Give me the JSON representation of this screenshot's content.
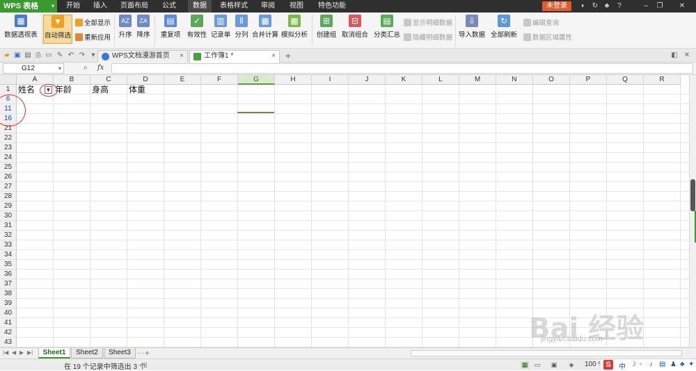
{
  "app": {
    "name": "WPS 表格",
    "dropdown": "▾"
  },
  "menu": {
    "tabs": [
      "开始",
      "插入",
      "页面布局",
      "公式",
      "数据",
      "表格样式",
      "审阅",
      "视图",
      "特色功能"
    ],
    "active": "数据",
    "login": "未登录"
  },
  "ribbon": {
    "pivot": "数据透视表",
    "autofilter": "自动筛选",
    "show_all": "全部显示",
    "reapply": "重新应用",
    "asc": "升序",
    "desc": "降序",
    "duplicates": "重复项",
    "validity": "有效性",
    "record": "记录单",
    "split": "分列",
    "consolidate": "合并计算",
    "whatif": "模拟分析",
    "group": "创建组",
    "ungroup": "取消组合",
    "subtotal": "分类汇总",
    "show_detail": "显示明细数据",
    "hide_detail": "隐藏明细数据",
    "import": "导入数据",
    "refresh_all": "全部刷新",
    "edit_query": "编辑查询",
    "area_props": "数据区域属性"
  },
  "doc_tabs": [
    {
      "label": "WPS文档漫游首页"
    },
    {
      "label": "工作簿1 *"
    }
  ],
  "formula": {
    "name_box": "G12",
    "fx": "fx"
  },
  "columns": [
    "A",
    "B",
    "C",
    "D",
    "E",
    "F",
    "G",
    "H",
    "I",
    "J",
    "K",
    "L",
    "M",
    "N",
    "O",
    "P",
    "Q",
    "R"
  ],
  "rows": [
    "1",
    "6",
    "11",
    "16",
    "21",
    "22",
    "23",
    "24",
    "25",
    "26",
    "27",
    "28",
    "29",
    "30",
    "31",
    "32",
    "33",
    "34",
    "35",
    "36",
    "37",
    "38",
    "39",
    "40",
    "41",
    "42",
    "43"
  ],
  "header_cells": {
    "a1": "姓名",
    "b1": "年龄",
    "c1": "身高",
    "d1": "体重"
  },
  "sheets": [
    "Sheet1",
    "Sheet2",
    "Sheet3"
  ],
  "status": {
    "text": "在 19 个记录中筛选出 3 个",
    "zoom": "100 %"
  },
  "ime": {
    "label": "中"
  },
  "watermark": {
    "main": "Bai 经验",
    "sub": "jingyan.baidu.com"
  }
}
